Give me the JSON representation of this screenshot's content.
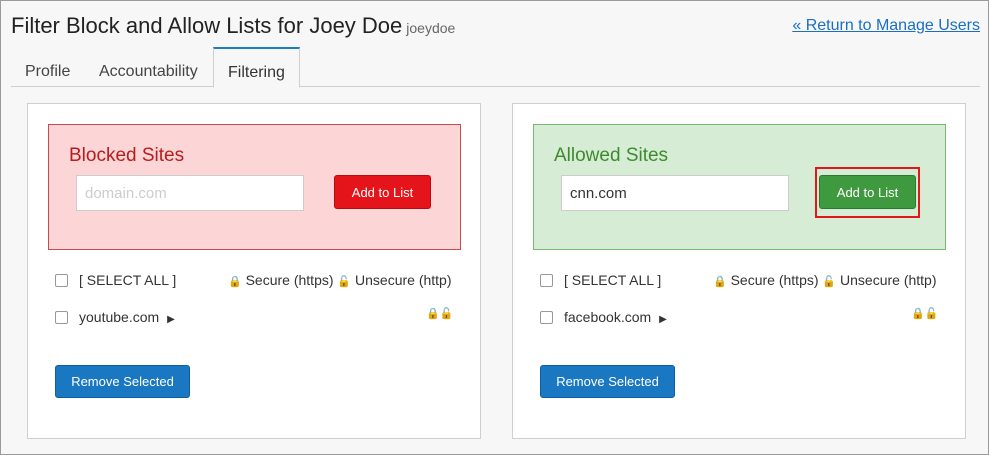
{
  "header": {
    "title": "Filter Block and Allow Lists for Joey Doe",
    "username": "joeydoe",
    "return_link": "« Return to Manage Users"
  },
  "tabs": [
    {
      "label": "Profile",
      "active": false
    },
    {
      "label": "Accountability",
      "active": false
    },
    {
      "label": "Filtering",
      "active": true
    }
  ],
  "blocked": {
    "title": "Blocked Sites",
    "input_value": "",
    "input_placeholder": "domain.com",
    "add_label": "Add to List",
    "select_all": "[ SELECT ALL ]",
    "secure_label": "Secure (https)",
    "unsecure_label": "Unsecure (http)",
    "sites": [
      {
        "domain": "youtube.com"
      }
    ],
    "remove_label": "Remove Selected"
  },
  "allowed": {
    "title": "Allowed Sites",
    "input_value": "cnn.com",
    "input_placeholder": "domain.com",
    "add_label": "Add to List",
    "select_all": "[ SELECT ALL ]",
    "secure_label": "Secure (https)",
    "unsecure_label": "Unsecure (http)",
    "sites": [
      {
        "domain": "facebook.com"
      }
    ],
    "remove_label": "Remove Selected"
  },
  "icons": {
    "lock": "🔒",
    "unlock": "🔓",
    "expand_arrow": "▶"
  },
  "colors": {
    "accent": "#1a78c2",
    "blocked": "#b81c1c",
    "allowed": "#3f8a2f"
  }
}
